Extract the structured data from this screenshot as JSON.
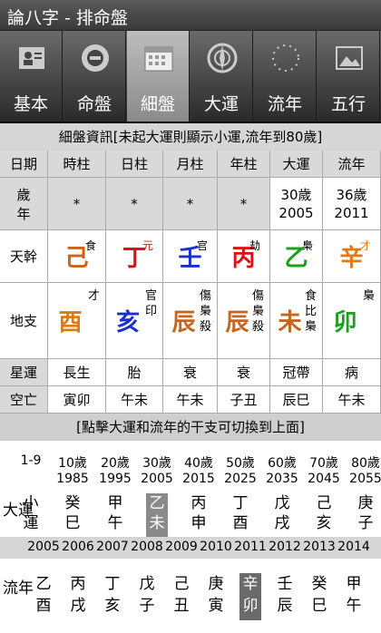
{
  "title": "論八字 - 排命盤",
  "tabs": [
    {
      "label": "基本",
      "icon": "person-card-icon"
    },
    {
      "label": "命盤",
      "icon": "disc-icon"
    },
    {
      "label": "細盤",
      "icon": "calendar-icon"
    },
    {
      "label": "大運",
      "icon": "compass-icon"
    },
    {
      "label": "流年",
      "icon": "dotted-circle-icon"
    },
    {
      "label": "五行",
      "icon": "landscape-icon"
    }
  ],
  "info_header": "細盤資訊[未起大運則顯示小運,流年到80歲]",
  "columns": [
    "日期",
    "時柱",
    "日柱",
    "月柱",
    "年柱",
    "大運",
    "流年"
  ],
  "age_row": {
    "label": "歲\n年",
    "values": [
      "*",
      "*",
      "*",
      "*",
      "30歲\n2005",
      "36歲\n2011"
    ]
  },
  "stem_row": {
    "label": "天幹",
    "chars": [
      "己",
      "丁",
      "壬",
      "丙",
      "乙",
      "辛"
    ],
    "subs": [
      "食",
      "元",
      "官",
      "劫",
      "梟",
      "才"
    ],
    "colors": [
      "#c8641e",
      "#e01010",
      "#1a2fd0",
      "#e01010",
      "#1aa01a",
      "#e07a10"
    ]
  },
  "branch_row": {
    "label": "地支",
    "chars": [
      "酉",
      "亥",
      "辰",
      "辰",
      "未",
      "卯"
    ],
    "subs": [
      "才",
      "官\n印",
      "傷\n梟\n殺",
      "傷\n梟\n殺",
      "食\n比\n梟",
      "梟"
    ],
    "colors": [
      "#e07a10",
      "#1a2fd0",
      "#c8641e",
      "#c8641e",
      "#c8641e",
      "#1aa01a"
    ]
  },
  "star_row": {
    "label": "星運",
    "values": [
      "長生",
      "胎",
      "衰",
      "衰",
      "冠帶",
      "病"
    ]
  },
  "void_row": {
    "label": "空亡",
    "values": [
      "寅卯",
      "午未",
      "午未",
      "子丑",
      "辰巳",
      "午未"
    ]
  },
  "click_hint": "[點擊大運和流年的干支可切換到上面]",
  "decades": {
    "ages": [
      "1-9",
      "10歲",
      "20歲",
      "30歲",
      "40歲",
      "50歲",
      "60歲",
      "70歲",
      "80歲"
    ],
    "years": [
      "",
      "1985",
      "1995",
      "2005",
      "2015",
      "2025",
      "2035",
      "2045",
      "2055"
    ],
    "label": "大運",
    "pillars": [
      [
        "小",
        "運"
      ],
      [
        "癸",
        "巳"
      ],
      [
        "甲",
        "午"
      ],
      [
        "乙",
        "未"
      ],
      [
        "丙",
        "申"
      ],
      [
        "丁",
        "酉"
      ],
      [
        "戊",
        "戌"
      ],
      [
        "己",
        "亥"
      ],
      [
        "庚",
        "子"
      ]
    ]
  },
  "annual": {
    "years": [
      "2005",
      "2006",
      "2007",
      "2008",
      "2009",
      "2010",
      "2011",
      "2012",
      "2013",
      "2014"
    ],
    "label": "流年",
    "pillars": [
      [
        "乙",
        "酉"
      ],
      [
        "丙",
        "戌"
      ],
      [
        "丁",
        "亥"
      ],
      [
        "戊",
        "子"
      ],
      [
        "己",
        "丑"
      ],
      [
        "庚",
        "寅"
      ],
      [
        "辛",
        "卯"
      ],
      [
        "壬",
        "辰"
      ],
      [
        "癸",
        "巳"
      ],
      [
        "甲",
        "午"
      ]
    ]
  }
}
